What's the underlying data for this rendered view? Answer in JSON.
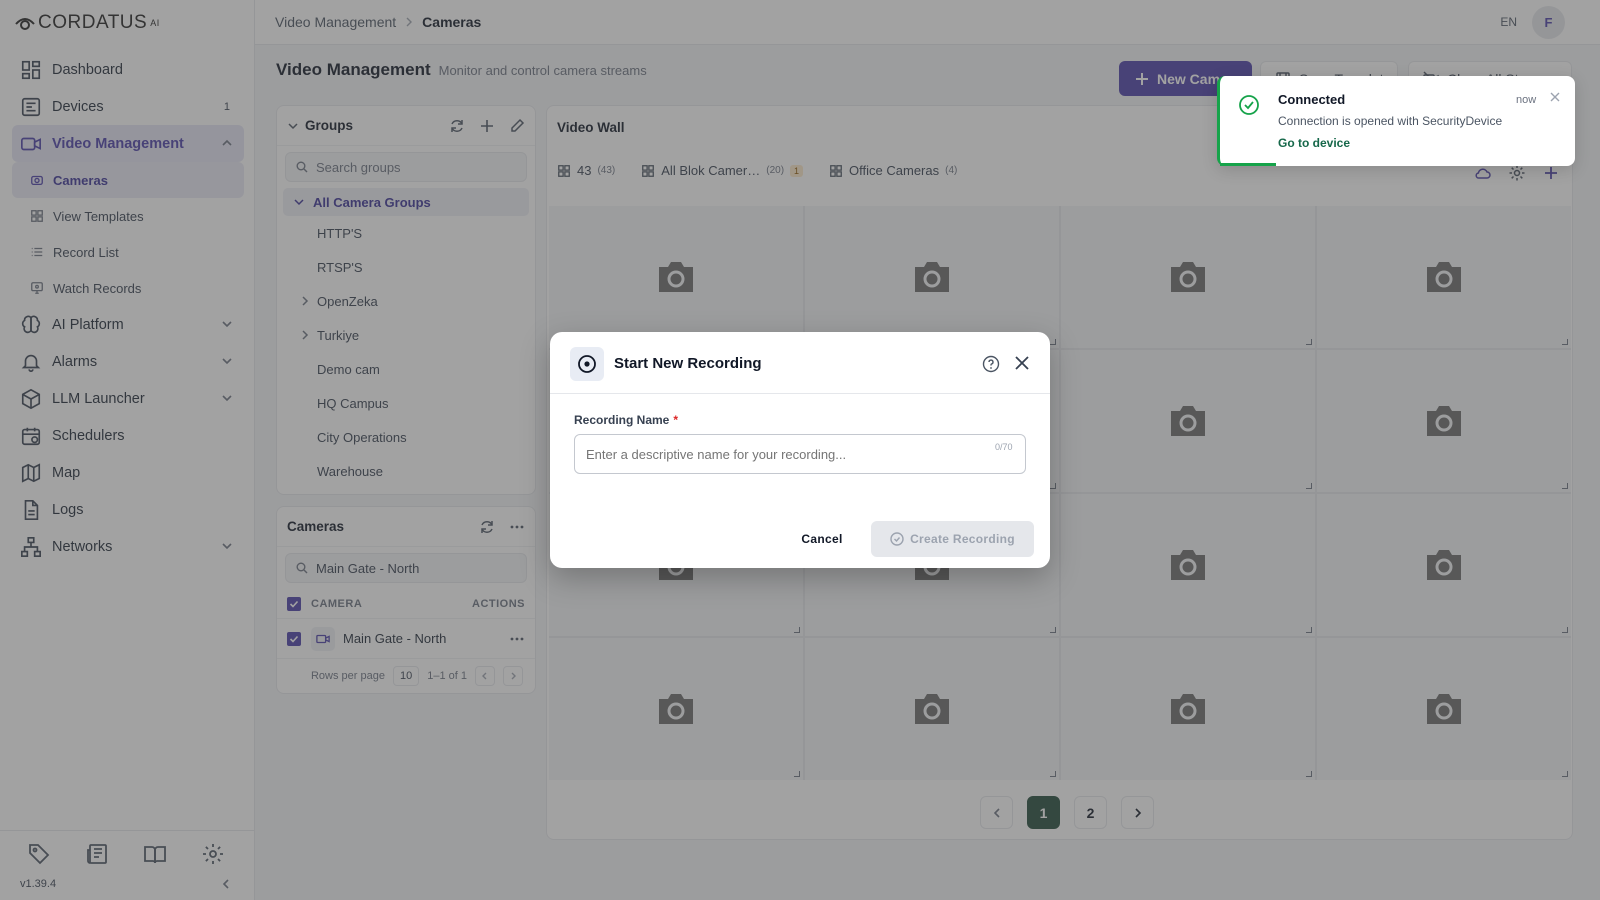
{
  "app": {
    "brand": "CORDATUS",
    "brand_suffix": "AI",
    "version": "v1.39.4"
  },
  "sidebar": {
    "items": [
      {
        "label": "Dashboard",
        "icon": "dashboard-icon"
      },
      {
        "label": "Devices",
        "icon": "devices-icon",
        "count": "1"
      },
      {
        "label": "Video Management",
        "icon": "video-icon",
        "expanded": true
      },
      {
        "label": "AI Platform",
        "icon": "brain-icon"
      },
      {
        "label": "Alarms",
        "icon": "bell-icon"
      },
      {
        "label": "LLM Launcher",
        "icon": "cube-icon"
      },
      {
        "label": "Schedulers",
        "icon": "calendar-icon"
      },
      {
        "label": "Map",
        "icon": "map-icon"
      },
      {
        "label": "Logs",
        "icon": "file-icon"
      },
      {
        "label": "Networks",
        "icon": "network-icon"
      }
    ],
    "sub_items": [
      {
        "label": "Cameras",
        "icon": "camera-icon",
        "active": true
      },
      {
        "label": "View Templates",
        "icon": "grid-icon"
      },
      {
        "label": "Record List",
        "icon": "list-icon"
      },
      {
        "label": "Watch Records",
        "icon": "monitor-icon"
      }
    ]
  },
  "topbar": {
    "breadcrumb_parent": "Video Management",
    "breadcrumb_current": "Cameras",
    "language": "EN",
    "avatar_initial": "F"
  },
  "page": {
    "title": "Video Management",
    "subtitle": "Monitor and control camera streams",
    "new_camera_label": "New Camera",
    "save_template_label": "Save Template",
    "close_all_label": "Close All Streams"
  },
  "groups": {
    "title": "Groups",
    "search_placeholder": "Search groups",
    "root": "All Camera Groups",
    "items": [
      {
        "label": "HTTP'S",
        "expandable": false
      },
      {
        "label": "RTSP'S",
        "expandable": false
      },
      {
        "label": "OpenZeka",
        "expandable": true
      },
      {
        "label": "Turkiye",
        "expandable": true
      },
      {
        "label": "Demo cam",
        "expandable": false
      },
      {
        "label": "HQ Campus",
        "expandable": false
      },
      {
        "label": "City Operations",
        "expandable": false
      },
      {
        "label": "Warehouse",
        "expandable": false
      }
    ]
  },
  "cameras": {
    "title": "Cameras",
    "search_value": "Main Gate - North",
    "col_camera": "CAMERA",
    "col_actions": "ACTIONS",
    "rows": [
      {
        "name": "Main Gate - North"
      }
    ],
    "rows_per_page_label": "Rows per page",
    "rows_per_page": "10",
    "range": "1–1 of 1"
  },
  "video_wall": {
    "title": "Video Wall",
    "tabs": [
      {
        "label": "43",
        "count": "(43)",
        "badge": ""
      },
      {
        "label": "All Blok Camer…",
        "count": "(20)",
        "badge": "1"
      },
      {
        "label": "Office Cameras",
        "count": "(4)",
        "badge": ""
      }
    ],
    "pages": [
      "1",
      "2"
    ],
    "current_page": "1"
  },
  "toast": {
    "title": "Connected",
    "message": "Connection is opened with SecurityDevice",
    "link": "Go to device",
    "time": "now"
  },
  "modal": {
    "title": "Start New Recording",
    "field_label": "Recording Name",
    "required_mark": "*",
    "placeholder": "Enter a descriptive name for your recording...",
    "counter": "0/70",
    "cancel_label": "Cancel",
    "create_label": "Create Recording"
  }
}
